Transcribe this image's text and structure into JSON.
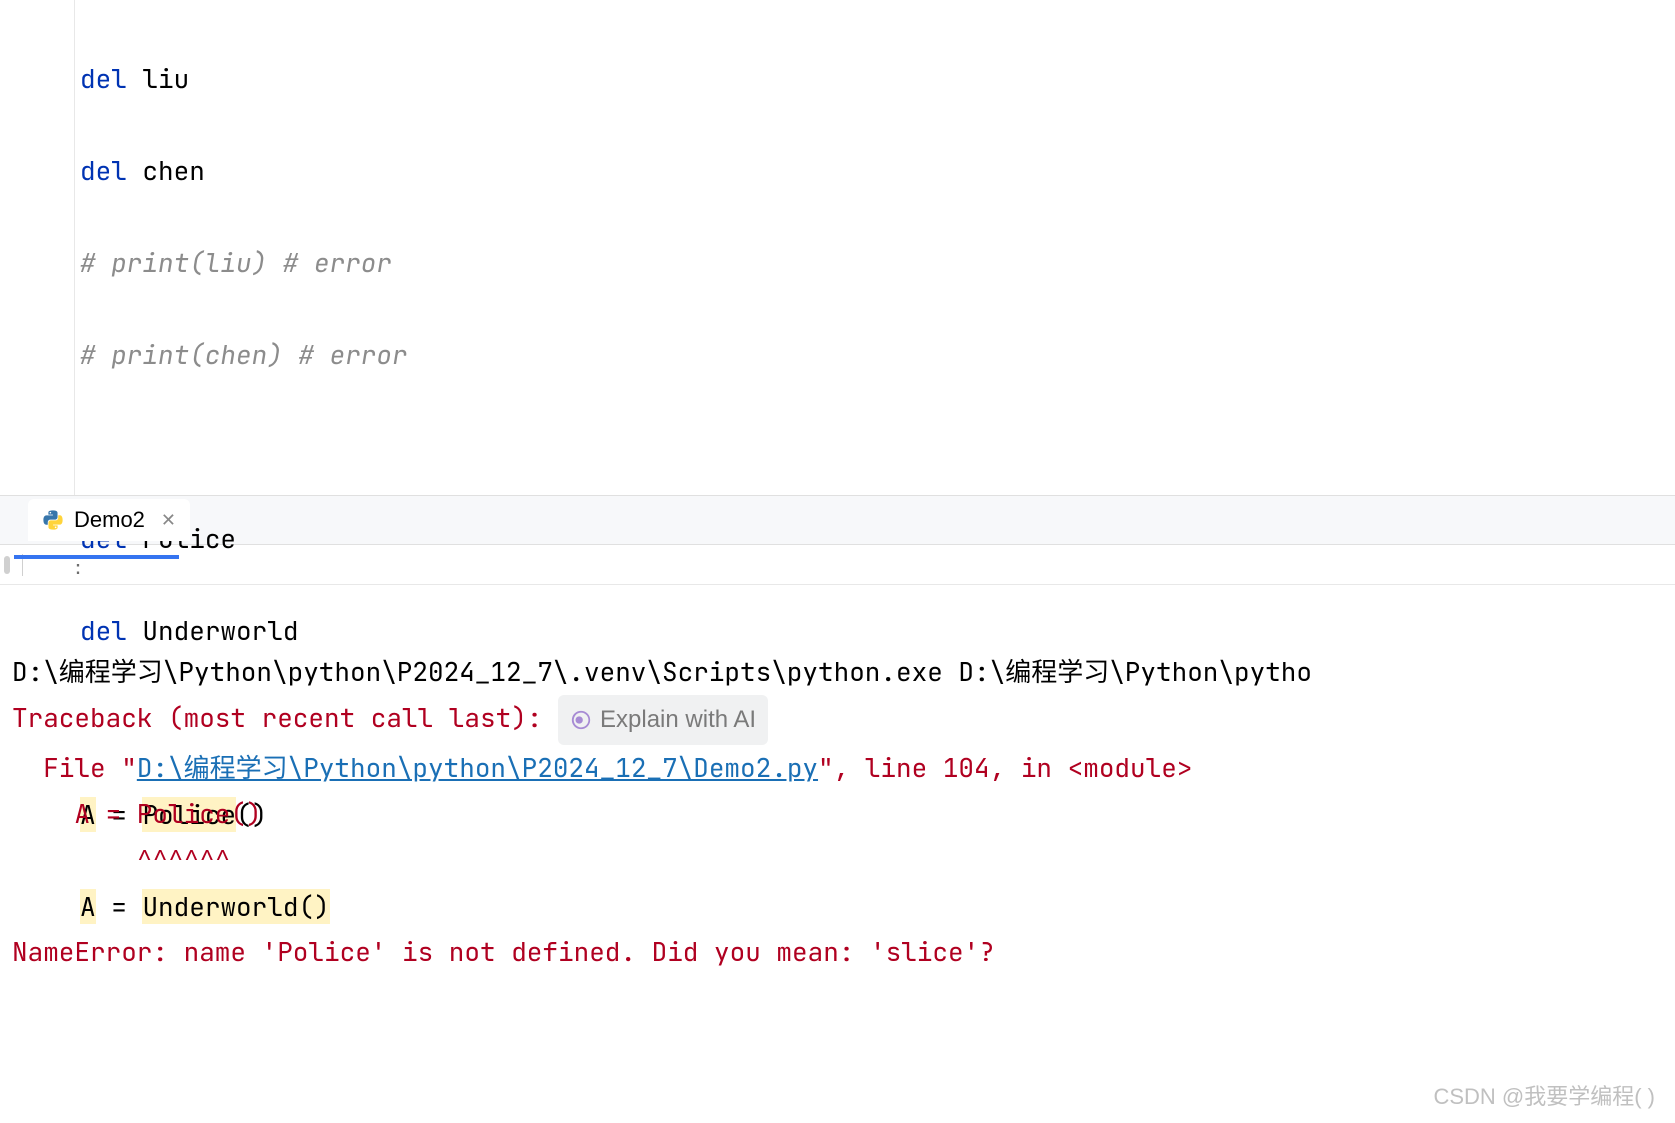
{
  "code": {
    "l1": {
      "kw": "del",
      "id": "liu"
    },
    "l2": {
      "kw": "del",
      "id": "chen"
    },
    "l3": "# print(liu) # error",
    "l4": "# print(chen) # error",
    "l6": {
      "kw": "del",
      "id": "Police"
    },
    "l7": {
      "kw": "del",
      "id": "Underworld"
    },
    "l9": {
      "a": "A",
      "eq": "=",
      "cls": "Police",
      "p": "()"
    },
    "l10": {
      "a": "A",
      "eq": "=",
      "cls": "Underworld",
      "p": "()"
    }
  },
  "tab": {
    "name": "Demo2"
  },
  "console": {
    "cmd": "D:\\编程学习\\Python\\python\\P2024_12_7\\.venv\\Scripts\\python.exe D:\\编程学习\\Python\\pytho",
    "traceback": "Traceback (most recent call last):",
    "ai_label": "Explain with AI",
    "file_pre": "  File \"",
    "file_link": "D:\\编程学习\\Python\\python\\P2024_12_7\\Demo2.py",
    "file_post": "\", line 104, in <module>",
    "code_line": "    A = Police()",
    "carets": "        ^^^^^^",
    "error": "NameError: name 'Police' is not defined. Did you mean: 'slice'?"
  },
  "watermark": "CSDN @我要学编程( )"
}
